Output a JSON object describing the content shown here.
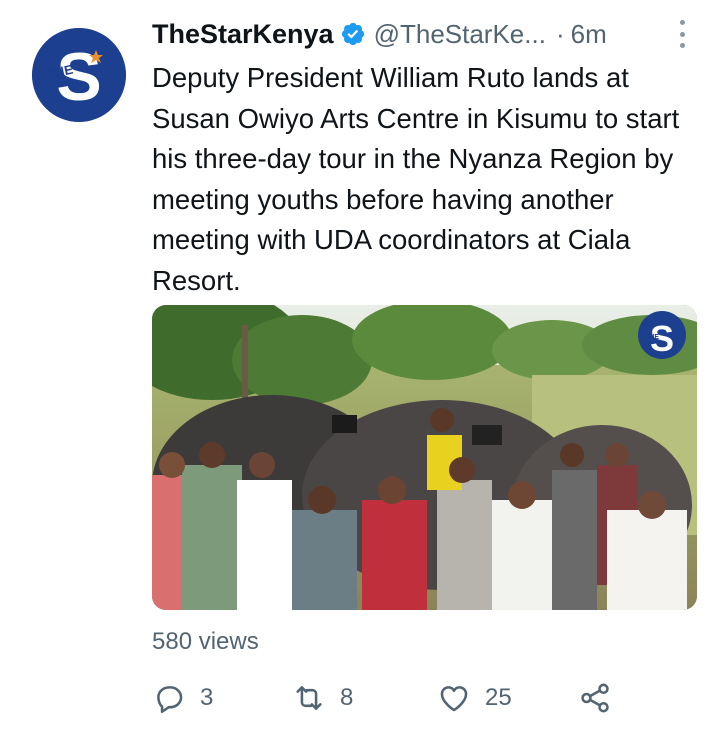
{
  "tweet": {
    "author_name": "TheStarKenya",
    "author_handle": "@TheStarKe...",
    "separator": "·",
    "time": "6m",
    "text": "Deputy President William Ruto lands at Susan Owiyo Arts Centre in Kisumu to start his three-day tour in the Nyanza Region by meeting youths before having another meeting with UDA coordinators at Ciala Resort.",
    "views": "580 views",
    "avatar_letters": "S",
    "avatar_small": "THE",
    "watermark_letters": "S",
    "watermark_small": "THE"
  },
  "actions": {
    "replies": "3",
    "retweets": "8",
    "likes": "25"
  },
  "colors": {
    "brand_blue": "#1d3f8f",
    "verified_blue": "#1d9bf0",
    "secondary_text": "#536471",
    "primary_text": "#0f1419"
  },
  "icons": [
    "verified-badge-icon",
    "more-options-icon",
    "reply-icon",
    "retweet-icon",
    "like-icon",
    "share-icon"
  ]
}
